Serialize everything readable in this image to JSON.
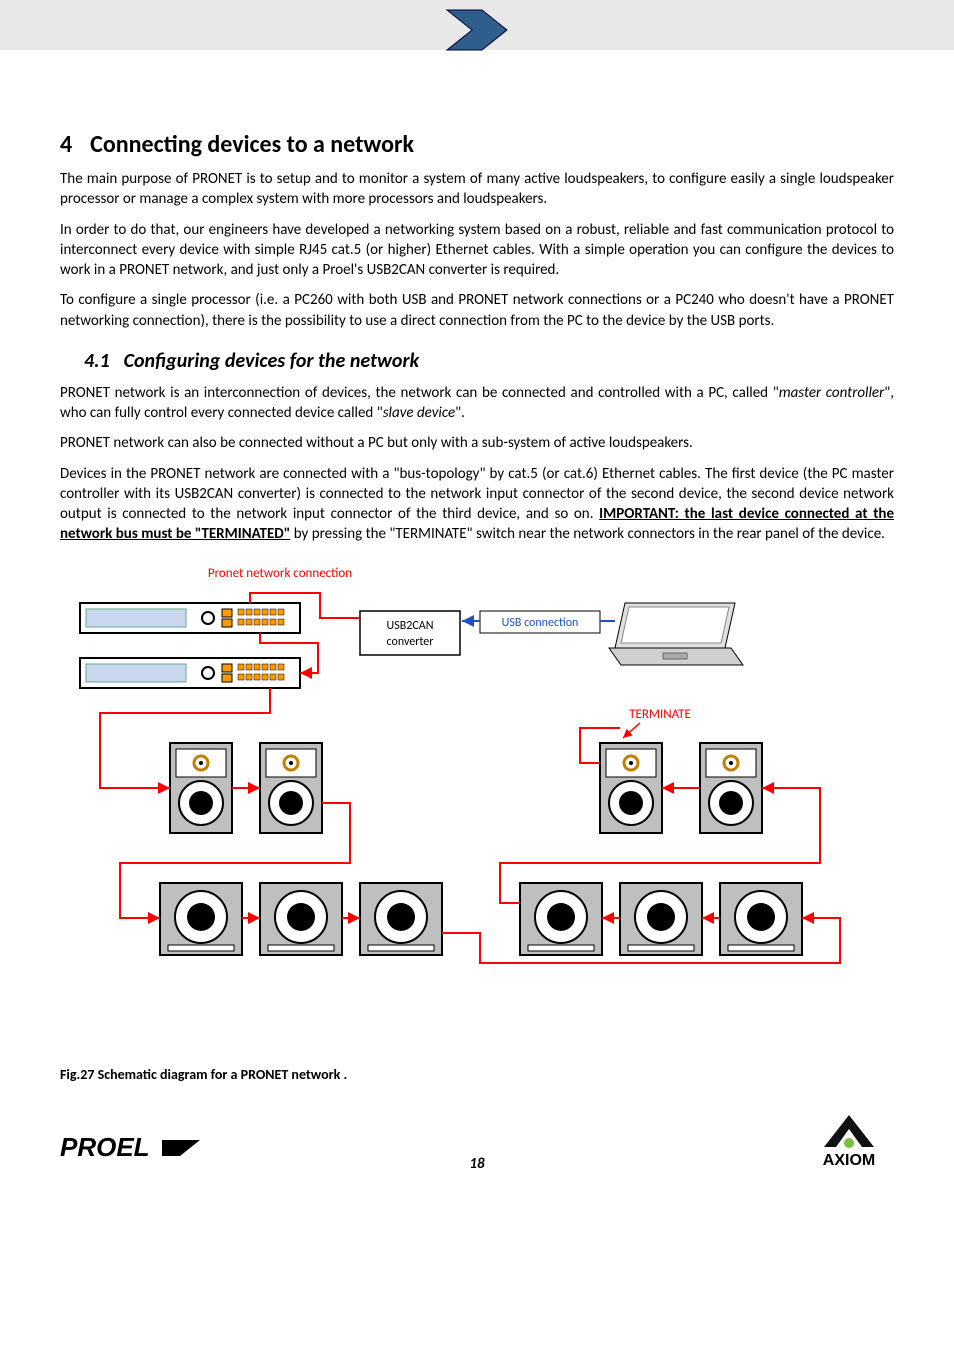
{
  "section": {
    "number": "4",
    "title": "Connecting devices to a network"
  },
  "subsection": {
    "number": "4.1",
    "title": "Configuring devices for the network"
  },
  "paragraphs": {
    "p1": "The main purpose of PRONET is to setup and to monitor a system of many active loudspeakers, to configure easily a single loudspeaker processor or manage a complex system with more processors and loudspeakers.",
    "p2": "In order to do that, our engineers have developed a networking system based on a robust, reliable and fast communication protocol to interconnect every device with simple RJ45 cat.5 (or higher) Ethernet cables. With a simple operation you can configure the devices to work in a PRONET network, and just only a Proel's USB2CAN converter is required.",
    "p3": "To configure a single processor (i.e. a PC260 with both USB and PRONET network connections or a PC240 who doesn't have a PRONET networking connection), there is the possibility to use a direct connection from the PC to the device by the USB ports.",
    "p4": "PRONET network is an interconnection of devices, the network can be connected and controlled with a PC, called \"",
    "p4_em1": "master controller",
    "p4_mid": "\", who can fully control every connected device called \"",
    "p4_em2": "slave device",
    "p4_end": "\".",
    "p5": "PRONET network can also be connected without a PC but only with a sub-system of active loudspeakers.",
    "p6a": "Devices in the PRONET network are connected with a \"bus-topology\" by cat.5 (or cat.6) Ethernet cables. The first device (the PC master controller with its USB2CAN converter) is connected to the network input connector of the second device, the second device network output is connected to the network input connector of the third device, and so on. ",
    "p6_important": "IMPORTANT: the last device connected at the network bus must be \"TERMINATED\"",
    "p6b": " by pressing the \"TERMINATE\" switch near the network connectors in the rear panel of the device."
  },
  "diagram": {
    "pronet_label": "Pronet network connection",
    "usb2can_l1": "USB2CAN",
    "usb2can_l2": "converter",
    "usb_conn": "USB connection",
    "terminate": "TERMINATE"
  },
  "figure_caption": "Fig.27 Schematic diagram for a PRONET network .",
  "page_number": "18",
  "logos": {
    "left": "PROEL",
    "right": "AXIOM"
  }
}
